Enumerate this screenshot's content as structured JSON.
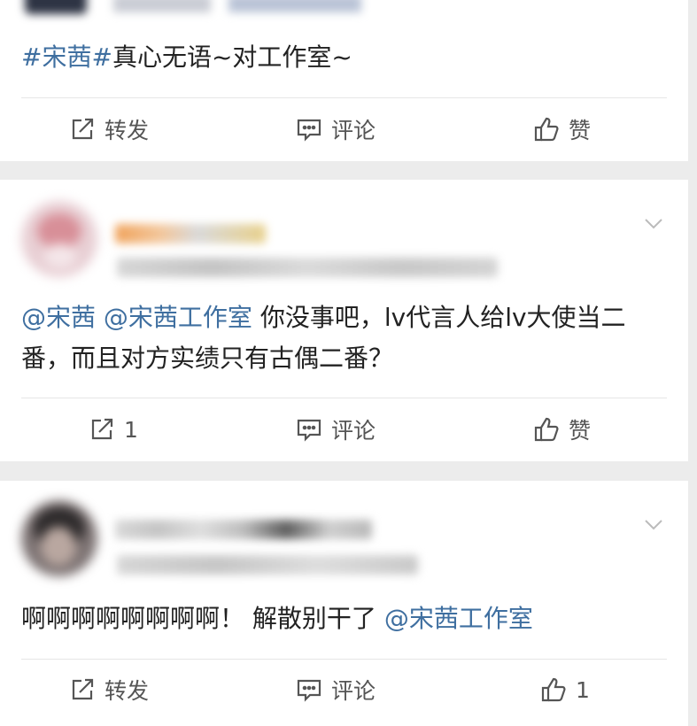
{
  "posts": [
    {
      "text_parts": [
        {
          "text": "#宋茜#",
          "link": true
        },
        {
          "text": "真心无语~对工作室~",
          "link": false
        }
      ],
      "actions": {
        "repost": "转发",
        "comment": "评论",
        "like": "赞"
      }
    },
    {
      "text_parts": [
        {
          "text": "@宋茜",
          "link": true
        },
        {
          "text": " ",
          "link": false
        },
        {
          "text": "@宋茜工作室",
          "link": true
        },
        {
          "text": " 你没事吧，lv代言人给lv大使当二番，而且对方实绩只有古偶二番？",
          "link": false
        }
      ],
      "actions": {
        "repost": "1",
        "comment": "评论",
        "like": "赞"
      }
    },
    {
      "text_parts": [
        {
          "text": "啊啊啊啊啊啊啊啊！ 解散别干了 ",
          "link": false
        },
        {
          "text": "@宋茜工作室",
          "link": true
        }
      ],
      "actions": {
        "repost": "转发",
        "comment": "评论",
        "like": "1"
      }
    }
  ],
  "icons": {
    "repost": "share-icon",
    "comment": "comment-icon",
    "like": "thumbs-up-icon",
    "menu": "chevron-down-icon"
  },
  "colors": {
    "link": "#3f6fa0",
    "text": "#222222",
    "action": "#555555",
    "background": "#ececec"
  }
}
